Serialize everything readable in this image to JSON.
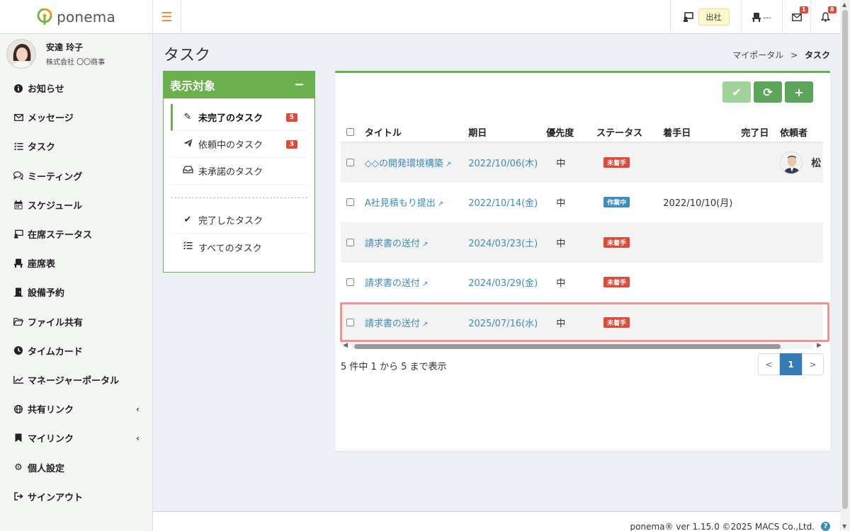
{
  "app": {
    "name": "ponema"
  },
  "topbar": {
    "presence_label": "出社",
    "seat_label": "---",
    "message_count": "1",
    "notification_count": "8"
  },
  "user": {
    "name": "安達 玲子",
    "company": "株式会社 〇〇商事"
  },
  "sidebar": {
    "items": [
      {
        "label": "お知らせ",
        "icon": "info-icon"
      },
      {
        "label": "メッセージ",
        "icon": "envelope-icon"
      },
      {
        "label": "タスク",
        "icon": "tasks-icon"
      },
      {
        "label": "ミーティング",
        "icon": "comments-icon"
      },
      {
        "label": "スケジュール",
        "icon": "calendar-icon"
      },
      {
        "label": "在席ステータス",
        "icon": "presence-icon"
      },
      {
        "label": "座席表",
        "icon": "chair-icon"
      },
      {
        "label": "設備予約",
        "icon": "door-icon"
      },
      {
        "label": "ファイル共有",
        "icon": "folder-icon"
      },
      {
        "label": "タイムカード",
        "icon": "clock-icon"
      },
      {
        "label": "マネージャーポータル",
        "icon": "chart-icon"
      },
      {
        "label": "共有リンク",
        "icon": "globe-icon"
      },
      {
        "label": "マイリンク",
        "icon": "bookmark-icon"
      },
      {
        "label": "個人設定",
        "icon": "gear-icon"
      },
      {
        "label": "サインアウト",
        "icon": "signout-icon"
      }
    ]
  },
  "page": {
    "title": "タスク",
    "breadcrumb_home": "マイポータル",
    "breadcrumb_sep": ">",
    "breadcrumb_current": "タスク"
  },
  "filter": {
    "header": "表示対象",
    "items": [
      {
        "label": "未完了のタスク",
        "count": "5"
      },
      {
        "label": "依頼中のタスク",
        "count": "3"
      },
      {
        "label": "未承諾のタスク"
      },
      {
        "label": "完了したタスク"
      },
      {
        "label": "すべてのタスク"
      }
    ]
  },
  "table": {
    "headers": [
      "タイトル",
      "期日",
      "優先度",
      "ステータス",
      "着手日",
      "完了日",
      "依頼者"
    ],
    "rows": [
      {
        "title": "◇◇の開発環境構築",
        "due": "2022/10/06(木)",
        "priority": "中",
        "status": "未着手",
        "started": "",
        "completed": "",
        "requester": "松"
      },
      {
        "title": "A社見積もり提出",
        "due": "2022/10/14(金)",
        "priority": "中",
        "status": "作業中",
        "started": "2022/10/10(月)",
        "completed": "",
        "requester": ""
      },
      {
        "title": "請求書の送付",
        "due": "2024/03/23(土)",
        "priority": "中",
        "status": "未着手",
        "started": "",
        "completed": "",
        "requester": ""
      },
      {
        "title": "請求書の送付",
        "due": "2024/03/29(金)",
        "priority": "中",
        "status": "未着手",
        "started": "",
        "completed": "",
        "requester": ""
      },
      {
        "title": "請求書の送付",
        "due": "2025/07/16(水)",
        "priority": "中",
        "status": "未着手",
        "started": "",
        "completed": "",
        "requester": ""
      }
    ]
  },
  "pager": {
    "info": "5 件中 1 から 5 まで表示",
    "prev": "<",
    "current": "1",
    "next": ">"
  },
  "footer": {
    "text": "ponema® ver 1.15.0 ©2025 MACS Co.,Ltd.",
    "help": "?"
  },
  "colors": {
    "accent": "#6ab04c",
    "link": "#3c8dbc",
    "danger": "#dd4b39",
    "highlight": "#f29393"
  }
}
